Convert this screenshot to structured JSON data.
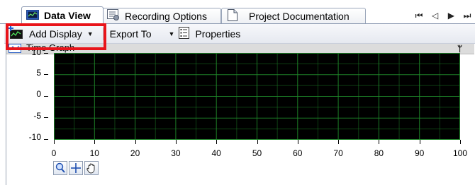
{
  "tabs": [
    {
      "label": "Data View",
      "active": true,
      "icon": "data-view-icon"
    },
    {
      "label": "Recording Options",
      "active": false,
      "icon": "recording-options-icon"
    },
    {
      "label": "Project Documentation",
      "active": false,
      "icon": "document-icon"
    }
  ],
  "nav": {
    "first": "first-tab-icon",
    "prev": "prev-tab-icon",
    "next": "next-tab-icon",
    "last": "last-tab-icon"
  },
  "toolbar": {
    "add_display_label": "Add Display",
    "export_label": "Export To",
    "properties_label": "Properties"
  },
  "panel": {
    "title": "Time Graph",
    "pin_glyph": "ᛘ"
  },
  "graph": {
    "y_ticks": [
      "10",
      "5",
      "0",
      "-5",
      "-10"
    ],
    "x_ticks": [
      "0",
      "10",
      "20",
      "30",
      "40",
      "50",
      "60",
      "70",
      "80",
      "90",
      "100"
    ],
    "x_range": [
      0,
      100
    ],
    "y_range": [
      -10,
      10
    ],
    "background_color": "#000000",
    "grid_color": "#1f8a2a",
    "grid": true
  },
  "graph_tools": [
    "zoom-icon",
    "cursor-crosshair-icon",
    "pan-hand-icon"
  ],
  "highlight_color": "#e8141a"
}
